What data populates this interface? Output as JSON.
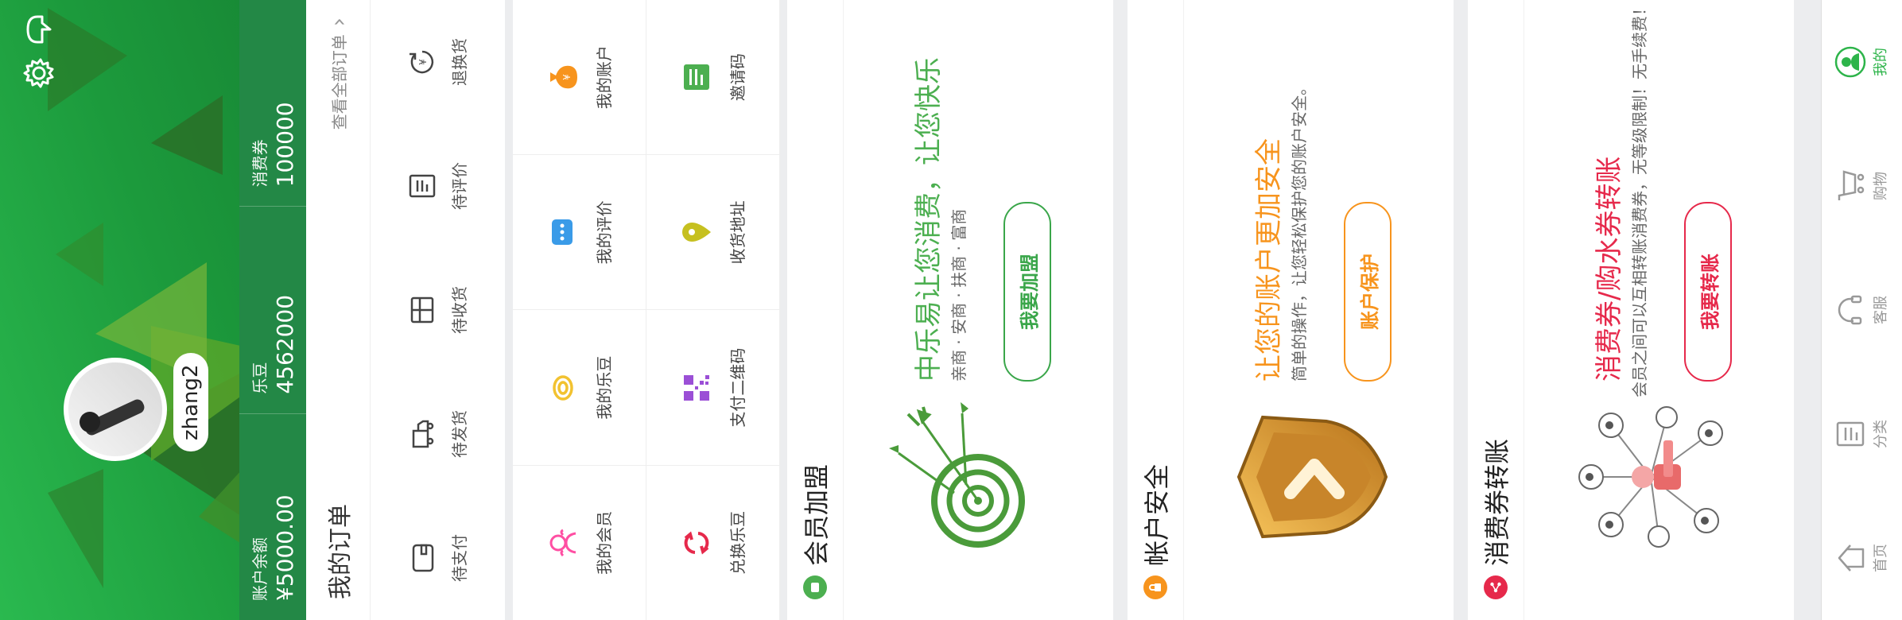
{
  "profile": {
    "username": "zhang2",
    "stats": [
      {
        "label": "账户余额",
        "value": "¥5000.00"
      },
      {
        "label": "乐豆",
        "value": "4562000"
      },
      {
        "label": "消费券",
        "value": "100000"
      }
    ]
  },
  "header": {
    "settings_icon": "gear-icon",
    "message_icon": "message-icon"
  },
  "orders": {
    "title": "我的订单",
    "view_all": "查看全部订单",
    "items": [
      {
        "label": "待支付",
        "icon": "wallet-icon"
      },
      {
        "label": "待发货",
        "icon": "truck-icon"
      },
      {
        "label": "待收货",
        "icon": "package-icon"
      },
      {
        "label": "待评价",
        "icon": "review-icon"
      },
      {
        "label": "退换货",
        "icon": "refund-icon"
      }
    ]
  },
  "services": {
    "row1": [
      {
        "label": "我的会员",
        "icon": "members-icon",
        "color": "#ff4fa3"
      },
      {
        "label": "我的乐豆",
        "icon": "coin-icon",
        "color": "#f2c230"
      },
      {
        "label": "我的评价",
        "icon": "comment-icon",
        "color": "#3a9be8"
      },
      {
        "label": "我的账户",
        "icon": "money-bag-icon",
        "color": "#f7941d"
      }
    ],
    "row2": [
      {
        "label": "兑换乐豆",
        "icon": "exchange-icon",
        "color": "#e6294b"
      },
      {
        "label": "支付二维码",
        "icon": "qrcode-icon",
        "color": "#9b4fd6"
      },
      {
        "label": "收货地址",
        "icon": "location-icon",
        "color": "#c6c020"
      },
      {
        "label": "邀请码",
        "icon": "invite-code-icon",
        "color": "#4caf50"
      }
    ]
  },
  "cards": {
    "membership": {
      "title": "会员加盟",
      "headline": "中乐易让您消费，让您快乐",
      "subtitle": "亲商 · 安商 · 扶商 · 富商",
      "button": "我要加盟",
      "accent": "#4caf50"
    },
    "security": {
      "title": "帐户安全",
      "headline": "让您的账户更加安全",
      "subtitle": "简单的操作，让您轻松保护您的账户安全。",
      "button": "账户保护",
      "accent": "#f7941d"
    },
    "transfer": {
      "title": "消费券转账",
      "headline": "消费券/购水券转账",
      "subtitle": "会员之间可以互相转账消费券，无等级限制！无手续费！",
      "button": "我要转账",
      "accent": "#e6294b"
    }
  },
  "bottom_nav": [
    {
      "label": "首页",
      "icon": "home-icon",
      "active": false
    },
    {
      "label": "分类",
      "icon": "category-icon",
      "active": false
    },
    {
      "label": "客服",
      "icon": "headset-icon",
      "active": false
    },
    {
      "label": "购物",
      "icon": "cart-icon",
      "active": false
    },
    {
      "label": "我的",
      "icon": "user-icon",
      "active": true
    }
  ]
}
